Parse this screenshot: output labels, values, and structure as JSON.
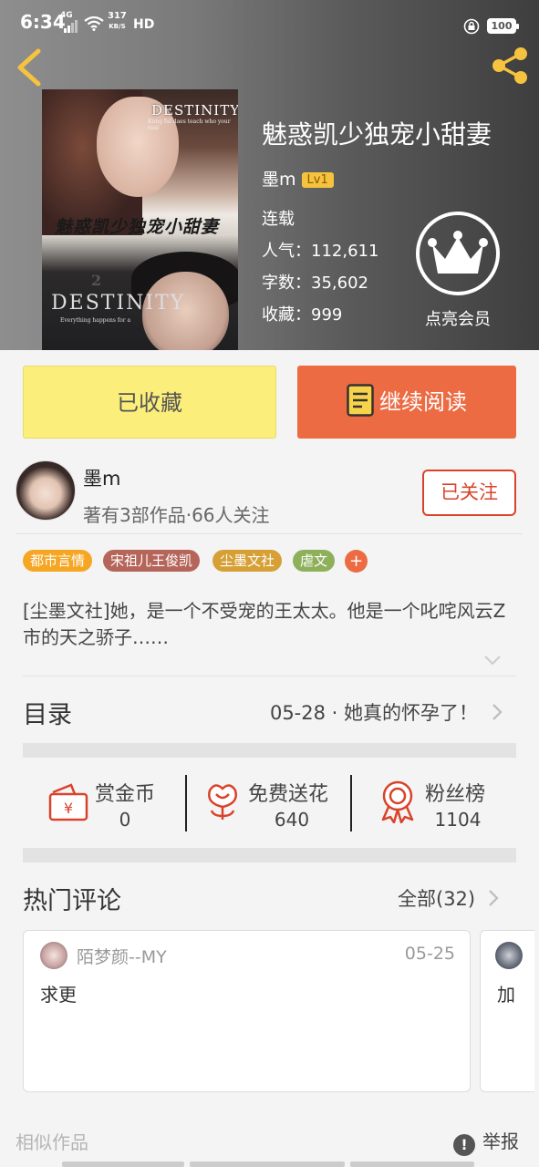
{
  "status_bar": {
    "time": "6:34",
    "network": "4G",
    "speed_value": "317",
    "speed_unit": "KB/S",
    "hd": "HD",
    "battery": "100"
  },
  "book": {
    "title": "魅惑凯少独宠小甜妻",
    "author": "墨m",
    "level": "Lv1",
    "status": "连载",
    "popularity_label": "人气：",
    "popularity": "112,611",
    "wordcount_label": "字数：",
    "wordcount": "35,602",
    "favorites_label": "收藏：",
    "favorites": "999",
    "cover": {
      "top_text": "DESTINITY",
      "top_subtext": "Kung ful daes teach who your real",
      "title_text": "魅惑凯少独宠小甜妻",
      "number": "2",
      "bottom_text": "DESTINITY",
      "bottom_subtext": "Everything happens for a"
    }
  },
  "vip": {
    "label": "点亮会员"
  },
  "actions": {
    "collected_label": "已收藏",
    "read_label": "继续阅读",
    "collected_color": "#fbee7a",
    "read_color": "#ec6b43"
  },
  "author_card": {
    "name": "墨m",
    "stats": "著有3部作品·66人关注",
    "follow_label": "已关注"
  },
  "tags": [
    {
      "label": "都市言情",
      "color": "#f5a623"
    },
    {
      "label": "宋祖儿王俊凯",
      "color": "#b5655a"
    },
    {
      "label": "尘墨文社",
      "color": "#d6a036"
    },
    {
      "label": "虐文",
      "color": "#8fb05a"
    }
  ],
  "tag_add": "+",
  "synopsis": "[尘墨文社]她，是一个不受宠的王太太。他是一个叱咤风云Z市的天之骄子……",
  "catalog": {
    "title": "目录",
    "latest": "05-28 · 她真的怀孕了！"
  },
  "stats": [
    {
      "label": "赏金币",
      "value": "0",
      "icon": "red-envelope-icon"
    },
    {
      "label": "免费送花",
      "value": "640",
      "icon": "flower-icon"
    },
    {
      "label": "粉丝榜",
      "value": "1104",
      "icon": "ribbon-medal-icon"
    }
  ],
  "comments": {
    "title": "热门评论",
    "all_label": "全部(32)",
    "items": [
      {
        "user": "陌梦颜--MY",
        "date": "05-25",
        "text": "求更"
      },
      {
        "user": "",
        "date": "",
        "text": "加"
      }
    ]
  },
  "footer": {
    "similar": "相似作品",
    "report": "举报",
    "report_icon": "!"
  }
}
